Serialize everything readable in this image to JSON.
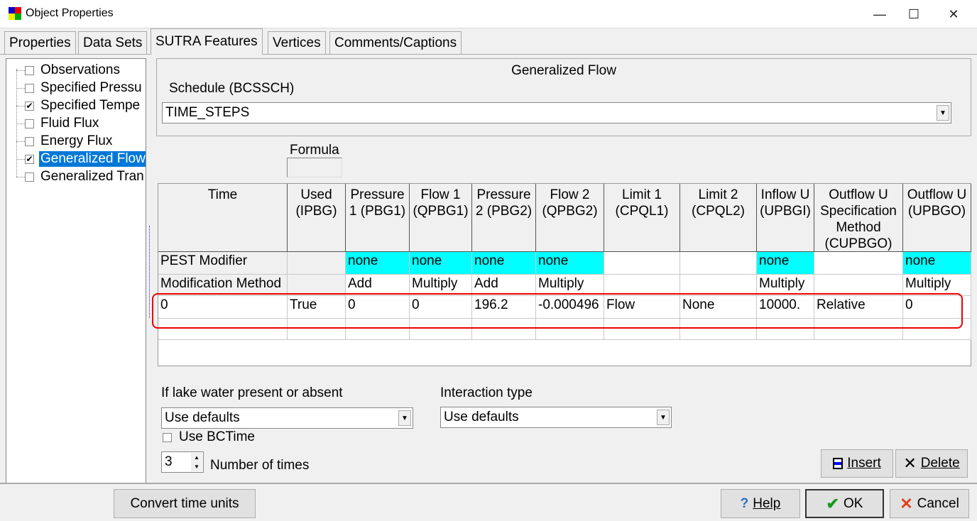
{
  "window": {
    "title": "Object Properties",
    "minimize": "—",
    "maximize": "☐",
    "close": "✕"
  },
  "tabs": [
    {
      "label": "Properties"
    },
    {
      "label": "Data Sets"
    },
    {
      "label": "SUTRA Features"
    },
    {
      "label": "Vertices"
    },
    {
      "label": "Comments/Captions"
    }
  ],
  "tree": [
    {
      "label": "Observations",
      "checked": false
    },
    {
      "label": "Specified Pressu",
      "checked": false
    },
    {
      "label": "Specified Tempe",
      "checked": true
    },
    {
      "label": "Fluid Flux",
      "checked": false
    },
    {
      "label": "Energy Flux",
      "checked": false
    },
    {
      "label": "Generalized Flow",
      "checked": true,
      "selected": true
    },
    {
      "label": "Generalized Tran",
      "checked": false
    }
  ],
  "section": {
    "title": "Generalized Flow",
    "schedule_label": "Schedule (BCSSCH)",
    "schedule_value": "TIME_STEPS",
    "formula_label": "Formula"
  },
  "table": {
    "headers": [
      "Time",
      "Used (IPBG)",
      "Pressure 1 (PBG1)",
      "Flow 1 (QPBG1)",
      "Pressure 2 (PBG2)",
      "Flow 2 (QPBG2)",
      "Limit 1 (CPQL1)",
      "Limit 2 (CPQL2)",
      "Inflow U (UPBGI)",
      "Outflow U Specification Method (CUPBGO)",
      "Outflow U (UPBGO)"
    ],
    "pest_row": [
      "PEST Modifier",
      "",
      "none",
      "none",
      "none",
      "none",
      "",
      "",
      "none",
      "",
      "none"
    ],
    "method_row": [
      "Modification Method",
      "",
      "Add",
      "Multiply",
      "Add",
      "Multiply",
      "",
      "",
      "Multiply",
      "",
      "Multiply"
    ],
    "rows": [
      [
        "0",
        "True",
        "0",
        "0",
        "196.2",
        "-0.000496",
        "Flow",
        "None",
        "10000.",
        "Relative",
        "0"
      ]
    ]
  },
  "lake": {
    "label": "If lake water present or absent",
    "value": "Use defaults"
  },
  "interaction": {
    "label": "Interaction type",
    "value": "Use defaults"
  },
  "use_bctime": {
    "label": "Use BCTime",
    "checked": false
  },
  "num_times": {
    "value": "3",
    "label": "Number of times"
  },
  "buttons": {
    "insert": "Insert",
    "delete": "Delete",
    "convert": "Convert time units",
    "help": "Help",
    "ok": "OK",
    "cancel": "Cancel"
  },
  "colors": {
    "pest_cell": "#00ffff",
    "selection": "#0078d7",
    "highlight_box": "#e00000"
  }
}
